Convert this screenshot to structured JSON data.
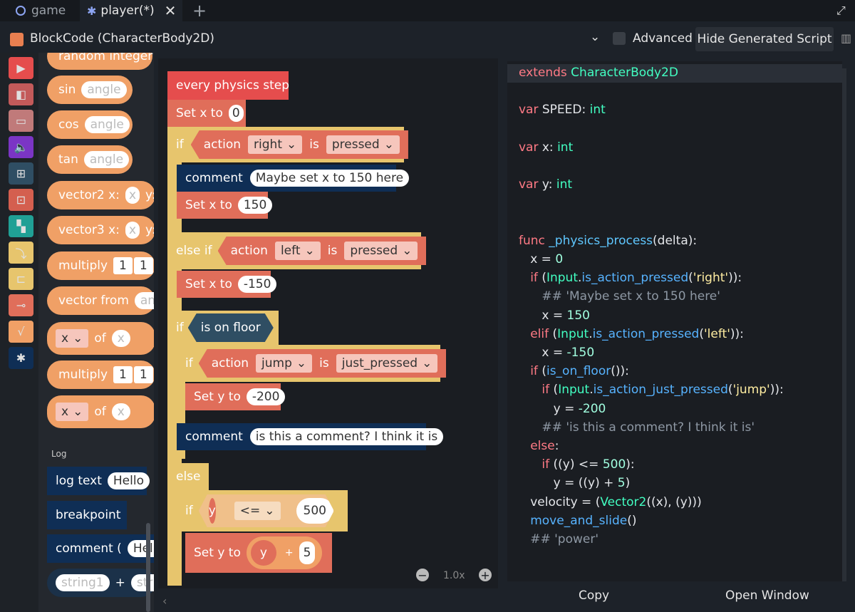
{
  "tabs": [
    {
      "label": "game"
    },
    {
      "label": "player(*)"
    }
  ],
  "header": {
    "title": "BlockCode (CharacterBody2D)",
    "advanced_label": "Advanced",
    "hide_label": "Hide Generated Script"
  },
  "palette": {
    "blocks": [
      "random integer",
      "sin",
      "cos",
      "tan",
      "vector2 x:",
      "vector3 x:",
      "multiply",
      "vector from",
      "of",
      "multiply",
      "of"
    ],
    "placeholders": {
      "angle": "angle",
      "x": "x",
      "y": "y:",
      "one": "1",
      "ang": "ang"
    },
    "log_section": "Log",
    "log_blocks": [
      "log text",
      "breakpoint",
      "comment (",
      "+"
    ],
    "log_values": {
      "hello": "Hello",
      "hello2": "Hello",
      "string1": "string1",
      "string2": "strin"
    }
  },
  "canvas": {
    "zoom": "1.0x",
    "event": "every physics step",
    "set_x": "Set x to",
    "set_y": "Set y to",
    "if": "if",
    "else_if": "else if",
    "else": "else",
    "action": "action",
    "is": "is",
    "comment": "comment",
    "right": "right",
    "left": "left",
    "jump": "jump",
    "pressed": "pressed",
    "just_pressed": "just_pressed",
    "is_on_floor": "is on floor",
    "v0": "0",
    "v150": "150",
    "vneg150": "-150",
    "vneg200": "-200",
    "v500": "500",
    "v5": "5",
    "op_le": "<=",
    "plus": "+",
    "y": "y",
    "comment1": "Maybe set x to 150 here",
    "comment2": "is this a comment? I think it is"
  },
  "code_panel": {
    "lines": [
      [
        [
          "kw",
          "extends "
        ],
        [
          "ty",
          "CharacterBody2D"
        ]
      ],
      [],
      [
        [
          "kw",
          "var "
        ],
        [
          "pl",
          "SPEED: "
        ],
        [
          "ty",
          "int"
        ]
      ],
      [],
      [
        [
          "kw",
          "var "
        ],
        [
          "pl",
          "x: "
        ],
        [
          "ty",
          "int"
        ]
      ],
      [],
      [
        [
          "kw",
          "var "
        ],
        [
          "pl",
          "y: "
        ],
        [
          "ty",
          "int"
        ]
      ],
      [],
      [],
      [
        [
          "kw",
          "func "
        ],
        [
          "fn",
          "_physics_process"
        ],
        [
          "pl",
          "(delta):"
        ]
      ],
      [
        [
          "pl",
          "    x = "
        ],
        [
          "nm",
          "0"
        ]
      ],
      [
        [
          "kw",
          "    if "
        ],
        [
          "pl",
          "("
        ],
        [
          "ty",
          "Input"
        ],
        [
          "pl",
          "."
        ],
        [
          "mt",
          "is_action_pressed"
        ],
        [
          "pl",
          "("
        ],
        [
          "st",
          "'right'"
        ],
        [
          "pl",
          "))"
        ],
        [
          "pl",
          ":"
        ]
      ],
      [
        [
          "cm",
          "        ## 'Maybe set x to 150 here'"
        ]
      ],
      [
        [
          "pl",
          "        x = "
        ],
        [
          "nm",
          "150"
        ]
      ],
      [
        [
          "kw",
          "    elif "
        ],
        [
          "pl",
          "("
        ],
        [
          "ty",
          "Input"
        ],
        [
          "pl",
          "."
        ],
        [
          "mt",
          "is_action_pressed"
        ],
        [
          "pl",
          "("
        ],
        [
          "st",
          "'left'"
        ],
        [
          "pl",
          "))"
        ],
        [
          "pl",
          ":"
        ]
      ],
      [
        [
          "pl",
          "        x = "
        ],
        [
          "nm",
          "-150"
        ]
      ],
      [
        [
          "kw",
          "    if "
        ],
        [
          "pl",
          "("
        ],
        [
          "mt",
          "is_on_floor"
        ],
        [
          "pl",
          "()):"
        ]
      ],
      [
        [
          "kw",
          "        if "
        ],
        [
          "pl",
          "("
        ],
        [
          "ty",
          "Input"
        ],
        [
          "pl",
          "."
        ],
        [
          "mt",
          "is_action_just_pressed"
        ],
        [
          "pl",
          "("
        ],
        [
          "st",
          "'jump'"
        ],
        [
          "pl",
          "))"
        ],
        [
          "pl",
          ":"
        ]
      ],
      [
        [
          "pl",
          "            y = "
        ],
        [
          "nm",
          "-200"
        ]
      ],
      [
        [
          "cm",
          "        ## 'is this a comment? I think it is'"
        ]
      ],
      [
        [
          "kw",
          "    else"
        ],
        [
          "pl",
          ":"
        ]
      ],
      [
        [
          "kw",
          "        if "
        ],
        [
          "pl",
          "((y) <= "
        ],
        [
          "nm",
          "500"
        ],
        [
          "pl",
          "):"
        ]
      ],
      [
        [
          "pl",
          "            y = ((y) + "
        ],
        [
          "nm",
          "5"
        ],
        [
          "pl",
          ")"
        ]
      ],
      [
        [
          "pl",
          "    velocity = ("
        ],
        [
          "ty",
          "Vector2"
        ],
        [
          "pl",
          "((x), (y)))"
        ]
      ],
      [
        [
          "mt",
          "    move_and_slide"
        ],
        [
          "pl",
          "()"
        ]
      ],
      [
        [
          "cm",
          "    ## 'power'"
        ]
      ]
    ],
    "copy_label": "Copy",
    "open_label": "Open Window"
  },
  "colors": {
    "orange": "#f0a066",
    "red": "#e54d4d",
    "salmon": "#e06e5a",
    "gold": "#e7c56d",
    "navy": "#0f2e55",
    "navy_dark": "#1b3149"
  }
}
